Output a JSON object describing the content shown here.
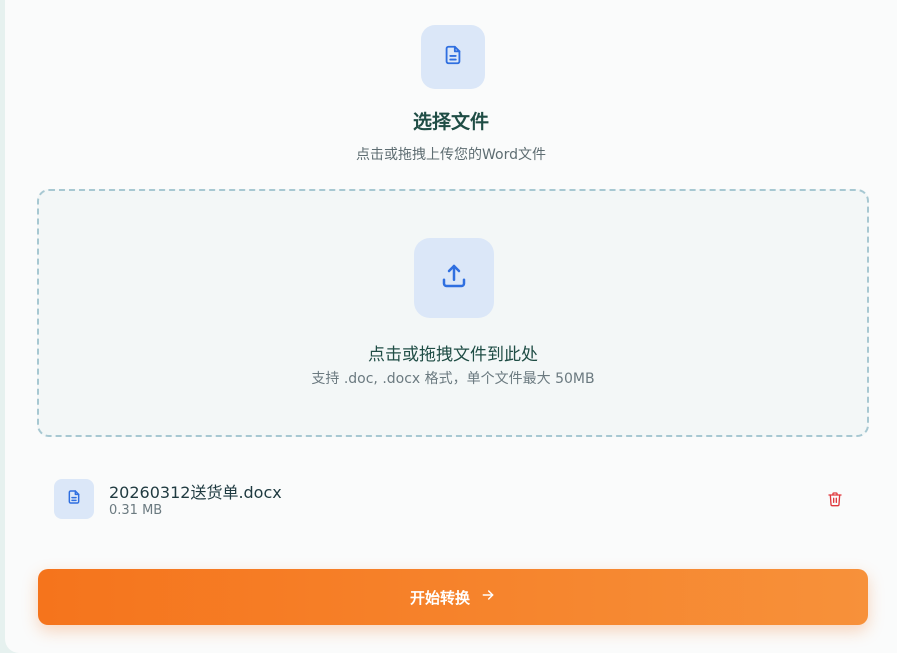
{
  "header": {
    "icon": "document-icon",
    "title": "选择文件",
    "subtitle": "点击或拖拽上传您的Word文件"
  },
  "dropzone": {
    "icon": "upload-icon",
    "main_text": "点击或拖拽文件到此处",
    "hint_text": "支持 .doc, .docx 格式，单个文件最大 50MB"
  },
  "file": {
    "icon": "document-icon",
    "name": "20260312送货单.docx",
    "size": "0.31 MB",
    "delete_icon": "trash-icon"
  },
  "action": {
    "label": "开始转换",
    "icon": "arrow-right-icon"
  },
  "colors": {
    "accent_orange": "#f5741c",
    "title_green": "#1f4d45",
    "icon_blue": "#2f6fe0",
    "delete_red": "#e0393e"
  }
}
